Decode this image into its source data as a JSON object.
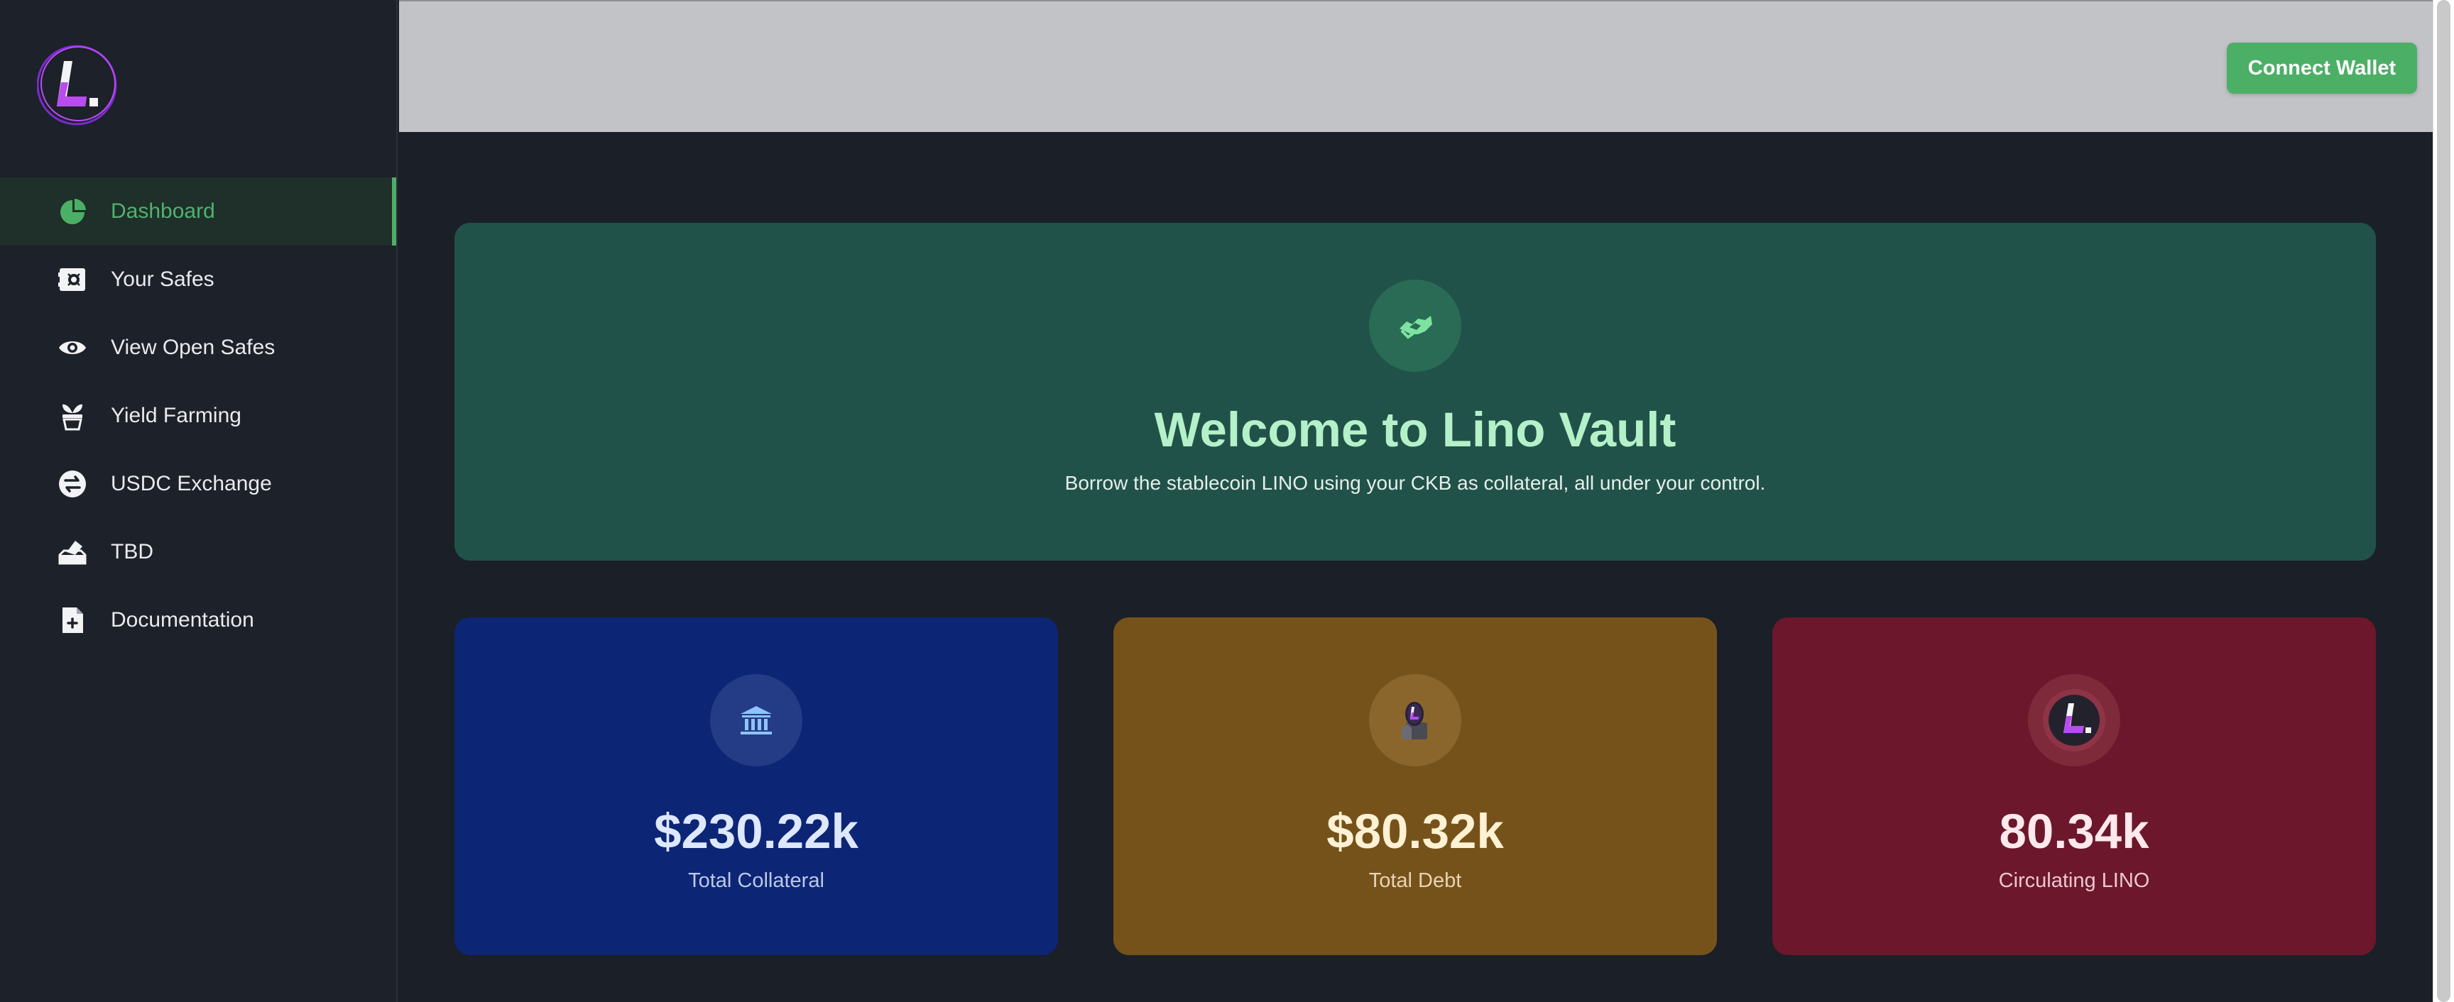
{
  "sidebar": {
    "logo_letter": "L",
    "items": [
      {
        "label": "Dashboard",
        "icon": "pie-chart-icon",
        "active": true
      },
      {
        "label": "Your Safes",
        "icon": "safe-icon",
        "active": false
      },
      {
        "label": "View Open Safes",
        "icon": "eye-icon",
        "active": false
      },
      {
        "label": "Yield Farming",
        "icon": "plant-pot-icon",
        "active": false
      },
      {
        "label": "USDC Exchange",
        "icon": "exchange-icon",
        "active": false
      },
      {
        "label": "TBD",
        "icon": "ballot-box-icon",
        "active": false
      },
      {
        "label": "Documentation",
        "icon": "document-icon",
        "active": false
      }
    ]
  },
  "header": {
    "connect_label": "Connect Wallet"
  },
  "welcome": {
    "title": "Welcome to Lino Vault",
    "subtitle": "Borrow the stablecoin LINO using your CKB as collateral, all under your control.",
    "icon": "handshake-icon"
  },
  "stats": [
    {
      "value": "$230.22k",
      "label": "Total Collateral",
      "icon": "bank-icon"
    },
    {
      "value": "$80.32k",
      "label": "Total Debt",
      "icon": "debt-token-icon"
    },
    {
      "value": "80.34k",
      "label": "Circulating LINO",
      "icon": "lino-token-icon"
    }
  ],
  "colors": {
    "accent": "#4caf66",
    "sidebar_bg": "#1d2129",
    "page_bg": "#1b1f27",
    "welcome_bg": "#21524a",
    "collateral_bg": "#0d2575",
    "debt_bg": "#76521b",
    "lino_bg": "#6c172b",
    "logo_purple": "#b84cf0"
  }
}
